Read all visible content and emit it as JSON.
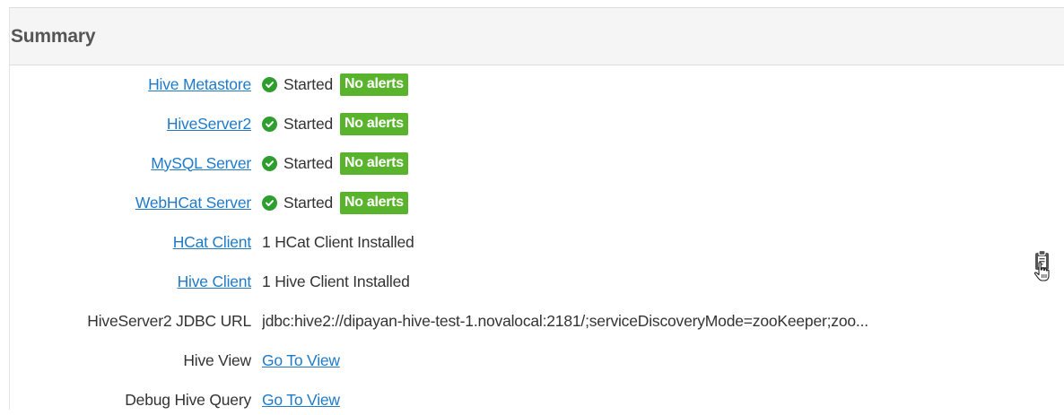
{
  "summary": {
    "title": "Summary",
    "components": [
      {
        "label": "Hive Metastore",
        "status": "Started",
        "alerts": "No alerts"
      },
      {
        "label": "HiveServer2",
        "status": "Started",
        "alerts": "No alerts"
      },
      {
        "label": "MySQL Server",
        "status": "Started",
        "alerts": "No alerts"
      },
      {
        "label": "WebHCat Server",
        "status": "Started",
        "alerts": "No alerts"
      }
    ],
    "clients": [
      {
        "label": "HCat Client",
        "value": "1 HCat Client Installed"
      },
      {
        "label": "Hive Client",
        "value": "1 Hive Client Installed"
      }
    ],
    "jdbc": {
      "label": "HiveServer2 JDBC URL",
      "value": "jdbc:hive2://dipayan-hive-test-1.novalocal:2181/;serviceDiscoveryMode=zooKeeper;zoo..."
    },
    "hive_view": {
      "label": "Hive View",
      "link": "Go To View"
    },
    "debug_query": {
      "label": "Debug Hive Query",
      "link": "Go To View"
    }
  },
  "colors": {
    "link": "#1f7ac7",
    "started_icon": "#2e9e2e",
    "badge": "#59b32c",
    "header_bg": "#f5f5f5"
  },
  "icons": {
    "status": "check-circle-icon",
    "copy": "clipboard-icon",
    "cursor": "hand-pointer-icon"
  }
}
